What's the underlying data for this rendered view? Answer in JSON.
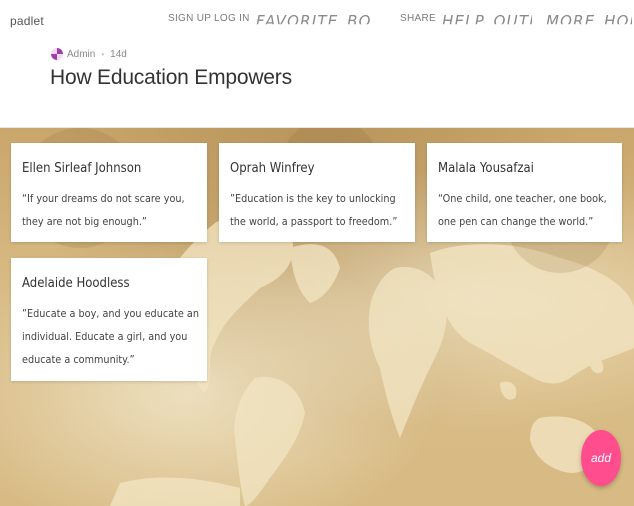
{
  "app": {
    "brand": "padlet"
  },
  "nav": {
    "signup": "SIGN UP",
    "login": "LOG IN",
    "favorite_border": "FAVORITE_BORDER",
    "share": "SHARE",
    "help_outline": "HELP_OUTLINE",
    "more_horiz": "MORE_HORIZ"
  },
  "header": {
    "author": "Admin",
    "age": "14d",
    "title": "How Education Empowers"
  },
  "posts": [
    {
      "name": "Ellen Sirleaf Johnson",
      "quote": "“If your dreams do not scare you, they are not big enough.”"
    },
    {
      "name": "Oprah Winfrey",
      "quote": "”Education is the key to unlocking the world, a passport to freedom.”"
    },
    {
      "name": "Malala Yousafzai",
      "quote": "“One child, one teacher, one book, one pen can change the world.”"
    },
    {
      "name": "Adelaide Hoodless",
      "quote": "”Educate a boy, and you educate an individual. Educate a girl, and you educate a community.”"
    }
  ],
  "fab": {
    "label": "add"
  },
  "colors": {
    "accent": "#ff4d8d",
    "avatar": "#a23ea8",
    "wall": "#d2b27a"
  }
}
